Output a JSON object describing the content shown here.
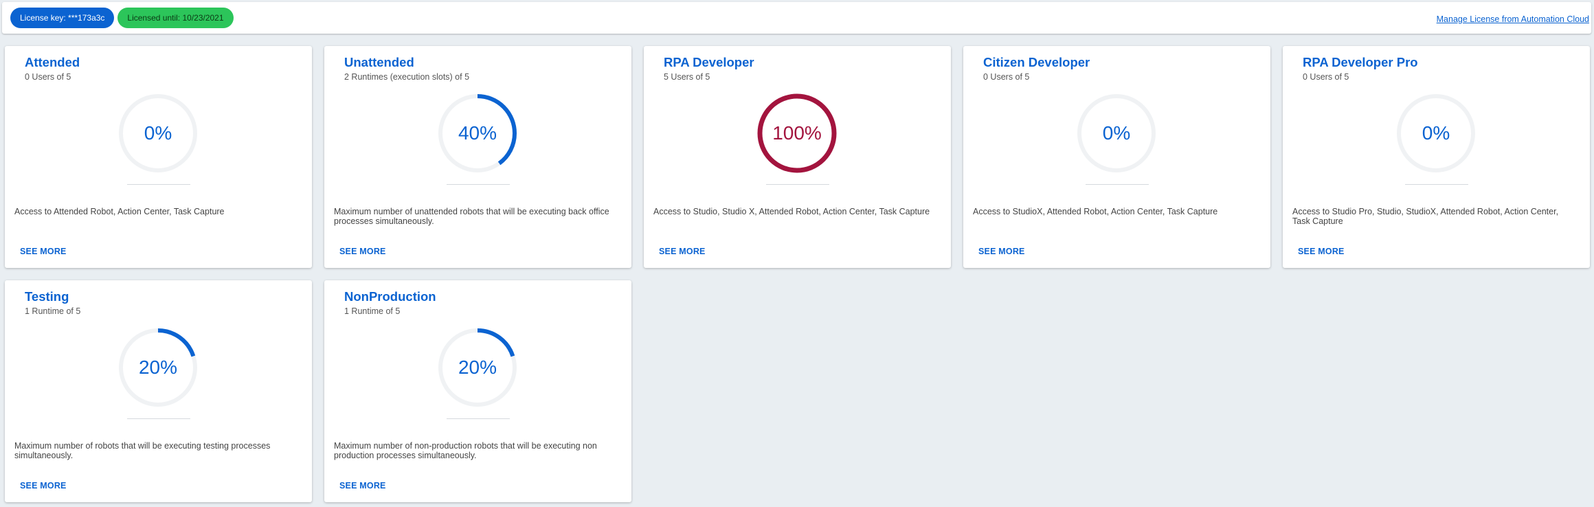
{
  "header": {
    "license_key_label": "License key: ***173a3c",
    "licensed_until_label": "Licensed until: 10/23/2021",
    "manage_link": "Manage License from Automation Cloud"
  },
  "colors": {
    "accent": "#0b63d1",
    "full": "#a3143e",
    "track": "#f0f2f4",
    "success_pill": "#2cc55a"
  },
  "cards": [
    {
      "title": "Attended",
      "subtitle": "0 Users of 5",
      "percent_label": "0%",
      "percent": 0,
      "description": "Access to Attended Robot, Action Center, Task Capture",
      "see_more": "SEE MORE"
    },
    {
      "title": "Unattended",
      "subtitle": "2 Runtimes (execution slots) of 5",
      "percent_label": "40%",
      "percent": 40,
      "description": "Maximum number of unattended robots that will be executing back office processes simultaneously.",
      "see_more": "SEE MORE"
    },
    {
      "title": "RPA Developer",
      "subtitle": "5 Users of 5",
      "percent_label": "100%",
      "percent": 100,
      "description": "Access to Studio, Studio X, Attended Robot, Action Center, Task Capture",
      "see_more": "SEE MORE"
    },
    {
      "title": "Citizen Developer",
      "subtitle": "0 Users of 5",
      "percent_label": "0%",
      "percent": 0,
      "description": "Access to StudioX, Attended Robot, Action Center, Task Capture",
      "see_more": "SEE MORE"
    },
    {
      "title": "RPA Developer Pro",
      "subtitle": "0 Users of 5",
      "percent_label": "0%",
      "percent": 0,
      "description": "Access to Studio Pro, Studio, StudioX, Attended Robot, Action Center, Task Capture",
      "see_more": "SEE MORE"
    },
    {
      "title": "Testing",
      "subtitle": "1 Runtime of 5",
      "percent_label": "20%",
      "percent": 20,
      "description": "Maximum number of robots that will be executing testing processes simultaneously.",
      "see_more": "SEE MORE"
    },
    {
      "title": "NonProduction",
      "subtitle": "1 Runtime of 5",
      "percent_label": "20%",
      "percent": 20,
      "description": "Maximum number of non-production robots that will be executing non production processes simultaneously.",
      "see_more": "SEE MORE"
    }
  ]
}
